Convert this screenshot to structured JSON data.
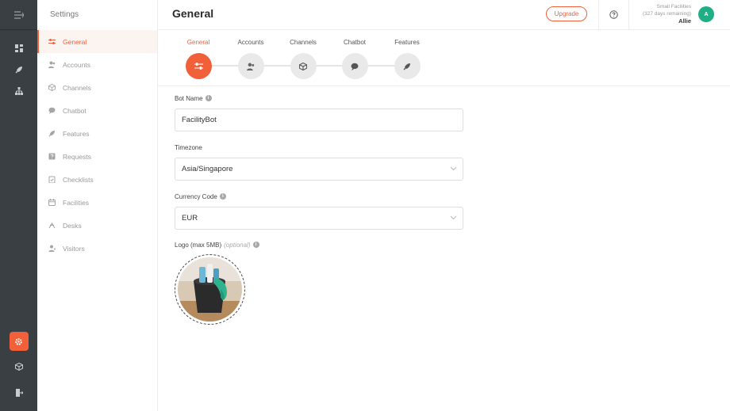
{
  "rail": {
    "icons": [
      "menu-collapse-icon",
      "dashboard-icon",
      "rocket-icon",
      "org-chart-icon",
      "settings-gear-icon",
      "cube-icon",
      "logout-icon"
    ],
    "accent": "#f2603a",
    "background": "#3a3f44"
  },
  "sidebar": {
    "title": "Settings",
    "items": [
      {
        "label": "General",
        "icon": "sliders-icon",
        "active": true
      },
      {
        "label": "Accounts",
        "icon": "users-icon"
      },
      {
        "label": "Channels",
        "icon": "cube-icon"
      },
      {
        "label": "Chatbot",
        "icon": "chat-bubble-icon"
      },
      {
        "label": "Features",
        "icon": "rocket-icon"
      },
      {
        "label": "Requests",
        "icon": "request-box-icon"
      },
      {
        "label": "Checklists",
        "icon": "clipboard-check-icon"
      },
      {
        "label": "Facilities",
        "icon": "calendar-icon"
      },
      {
        "label": "Desks",
        "icon": "desk-icon"
      },
      {
        "label": "Visitors",
        "icon": "visitor-icon"
      }
    ]
  },
  "header": {
    "title": "General",
    "upgrade_label": "Upgrade",
    "plan": "Small Facilities",
    "days": "(327 days remaining)",
    "user": "Allie",
    "avatar_initial": "A",
    "avatar_color": "#1fae86"
  },
  "stepper": {
    "steps": [
      {
        "label": "General",
        "icon": "sliders-icon",
        "active": true
      },
      {
        "label": "Accounts",
        "icon": "users-icon"
      },
      {
        "label": "Channels",
        "icon": "cube-icon"
      },
      {
        "label": "Chatbot",
        "icon": "chat-bubble-icon"
      },
      {
        "label": "Features",
        "icon": "rocket-icon"
      }
    ]
  },
  "form": {
    "bot_name_label": "Bot Name",
    "bot_name_value": "FacilityBot",
    "timezone_label": "Timezone",
    "timezone_value": "Asia/Singapore",
    "currency_label": "Currency Code",
    "currency_value": "EUR",
    "logo_label": "Logo (max 5MB)",
    "logo_optional": "(optional)",
    "info_glyph": "i"
  }
}
